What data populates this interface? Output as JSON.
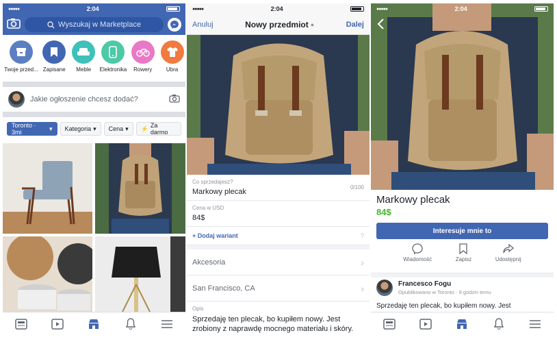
{
  "status": {
    "time": "2:04",
    "signal": "●●●●● ",
    "wifi": "◠"
  },
  "screen1": {
    "search_placeholder": "Wyszukaj w Marketplace",
    "categories": [
      {
        "label": "Twoje przed...",
        "color": "#5b7fc2",
        "icon": "box-icon"
      },
      {
        "label": "Zapisane",
        "color": "#4267b2",
        "icon": "bookmark-icon"
      },
      {
        "label": "Meble",
        "color": "#3ec1b9",
        "icon": "sofa-icon"
      },
      {
        "label": "Elektronika",
        "color": "#4cc9a6",
        "icon": "phone-icon"
      },
      {
        "label": "Rowery",
        "color": "#e978c7",
        "icon": "bike-icon"
      },
      {
        "label": "Ubra",
        "color": "#f07a3f",
        "icon": "shirt-icon"
      }
    ],
    "compose_prompt": "Jakie ogłoszenie chcesz dodać?",
    "filters": {
      "location": "Toronto · 3mi",
      "category": "Kategoria",
      "price": "Cena",
      "free": "Za darmo"
    }
  },
  "screen2": {
    "cancel": "Anuluj",
    "title": "Nowy przedmiot",
    "next": "Dalej",
    "what_label": "Co sprzedajesz?",
    "what_value": "Markowy plecak",
    "counter": "0/100",
    "price_label": "Cena w USD",
    "price_value": "84$",
    "add_variant": "+ Dodaj wariant",
    "category_value": "Akcesoria",
    "location_value": "San Francisco, CA",
    "desc_label": "Opis",
    "desc_value": "Sprzedaję ten plecak, bo kupiłem nowy. Jest zrobiony z naprawdę mocnego materiału i skóry."
  },
  "screen3": {
    "title": "Markowy plecak",
    "price": "84$",
    "cta": "Interesuje mnie to",
    "actions": [
      {
        "label": "Wiadomość",
        "icon": "messenger-icon"
      },
      {
        "label": "Zapisz",
        "icon": "bookmark-icon"
      },
      {
        "label": "Udostępnij",
        "icon": "share-icon"
      }
    ],
    "seller_name": "Francesco Fogu",
    "seller_meta": "Opublikowano w Toronto · 9 godzin temu",
    "desc": "Sprzedaję ten plecak, bo kupiłem nowy. Jest"
  },
  "colors": {
    "brand": "#4267b2",
    "price": "#42b72a"
  }
}
